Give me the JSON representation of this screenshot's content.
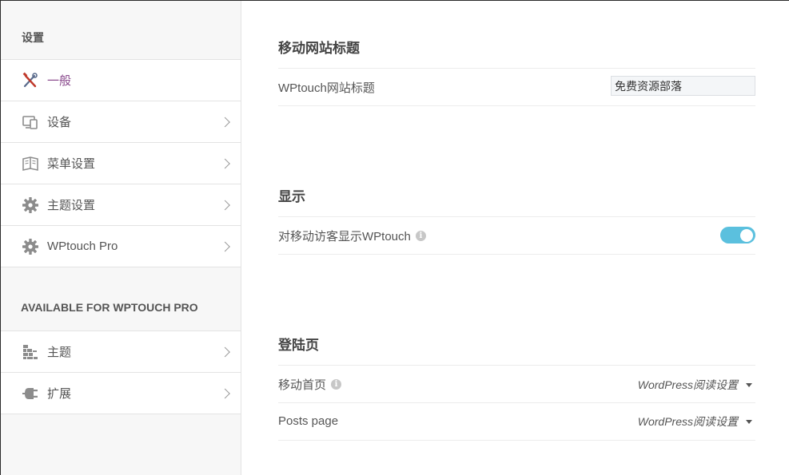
{
  "sidebar": {
    "heading": "设置",
    "items": [
      {
        "label": "一般",
        "icon": "tools-icon",
        "active": true
      },
      {
        "label": "设备",
        "icon": "devices-icon"
      },
      {
        "label": "菜单设置",
        "icon": "book-icon"
      },
      {
        "label": "主题设置",
        "icon": "gear-icon"
      },
      {
        "label": "WPtouch Pro",
        "icon": "gear-icon"
      }
    ],
    "pro_heading": "AVAILABLE FOR WPTOUCH PRO",
    "pro_items": [
      {
        "label": "主题",
        "icon": "bricks-icon"
      },
      {
        "label": "扩展",
        "icon": "plug-icon"
      }
    ]
  },
  "main": {
    "site_title_section": {
      "title": "移动网站标题",
      "field_label": "WPtouch网站标题",
      "field_value": "免费资源部落"
    },
    "display_section": {
      "title": "显示",
      "toggle_label": "对移动访客显示WPtouch",
      "toggle_on": true
    },
    "landing_section": {
      "title": "登陆页",
      "rows": [
        {
          "label": "移动首页",
          "value": "WordPress阅读设置",
          "has_info": true
        },
        {
          "label": "Posts page",
          "value": "WordPress阅读设置",
          "has_info": false
        }
      ]
    }
  },
  "colors": {
    "accent_toggle": "#5bc0de",
    "active_item": "#8a4a8d"
  }
}
